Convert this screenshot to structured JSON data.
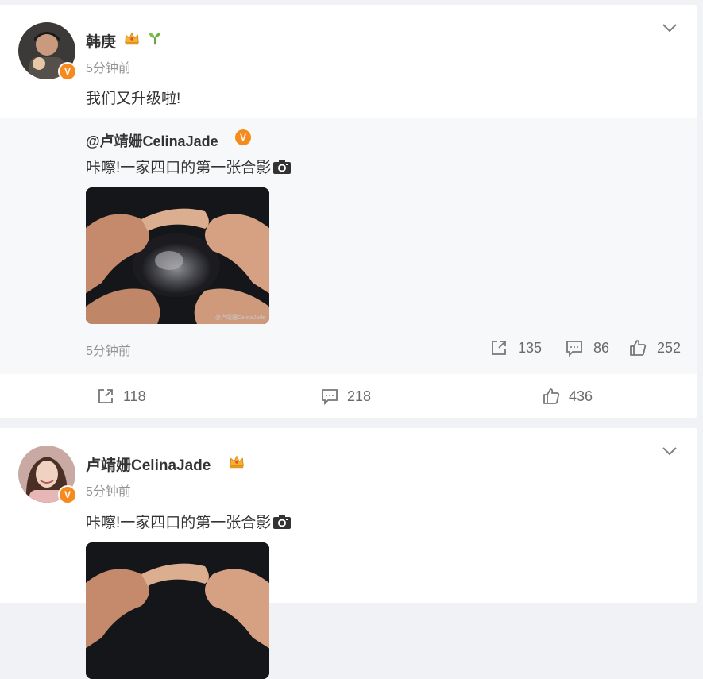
{
  "post1": {
    "username": "韩庚",
    "time": "5分钟前",
    "text": "我们又升级啦!",
    "repost": {
      "source": "@卢靖姗CelinaJade",
      "text": "咔嚓!一家四口的第一张合影",
      "watermark": "@卢靖姗CelinaJade",
      "time": "5分钟前",
      "reposts": "135",
      "comments": "86",
      "likes": "252"
    },
    "reposts": "118",
    "comments": "218",
    "likes": "436"
  },
  "post2": {
    "username": "卢靖姗CelinaJade",
    "time": "5分钟前",
    "text": "咔嚓!一家四口的第一张合影"
  },
  "colors": {
    "accent": "#f78a1d",
    "muted": "#939393",
    "background": "#f1f2f5"
  }
}
